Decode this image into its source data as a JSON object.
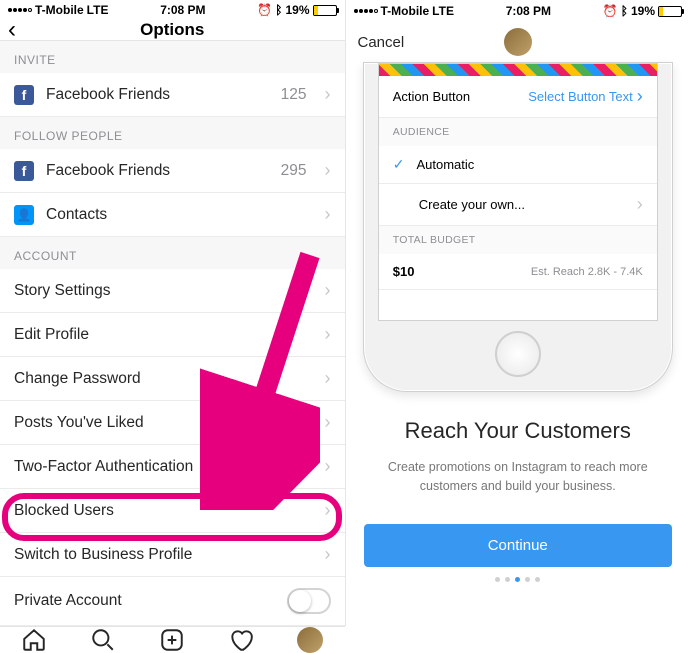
{
  "statusBar": {
    "carrier": "T-Mobile",
    "network": "LTE",
    "time": "7:08 PM",
    "batteryPercent": "19%"
  },
  "left": {
    "title": "Options",
    "sections": {
      "invite": {
        "header": "INVITE",
        "facebook": {
          "label": "Facebook Friends",
          "count": "125"
        }
      },
      "follow": {
        "header": "FOLLOW PEOPLE",
        "facebook": {
          "label": "Facebook Friends",
          "count": "295"
        },
        "contacts": {
          "label": "Contacts"
        }
      },
      "account": {
        "header": "ACCOUNT",
        "items": [
          {
            "label": "Story Settings"
          },
          {
            "label": "Edit Profile"
          },
          {
            "label": "Change Password"
          },
          {
            "label": "Posts You've Liked"
          },
          {
            "label": "Two-Factor Authentication"
          },
          {
            "label": "Blocked Users"
          },
          {
            "label": "Switch to Business Profile"
          },
          {
            "label": "Private Account"
          }
        ]
      }
    }
  },
  "right": {
    "cancel": "Cancel",
    "card": {
      "actionButton": {
        "label": "Action Button",
        "value": "Select Button Text"
      },
      "audienceHeader": "AUDIENCE",
      "automatic": "Automatic",
      "createOwn": "Create your own...",
      "budgetHeader": "TOTAL BUDGET",
      "budget": "$10",
      "reach": "Est. Reach 2.8K - 7.4K"
    },
    "promo": {
      "title": "Reach Your Customers",
      "subtitle": "Create promotions on Instagram to reach more customers and build your business.",
      "button": "Continue"
    }
  }
}
